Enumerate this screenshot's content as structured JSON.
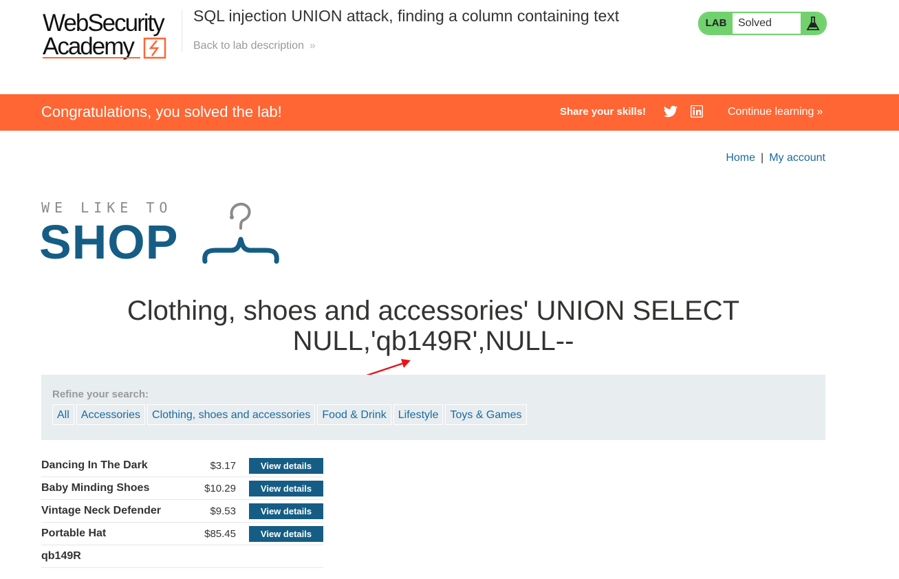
{
  "academy": {
    "logo_line1": "WebSecurity",
    "logo_line2": "Academy",
    "lab_title": "SQL injection UNION attack, finding a column containing text",
    "back_link": "Back to lab description",
    "lab_badge": "LAB",
    "lab_status": "Solved"
  },
  "banner": {
    "message": "Congratulations, you solved the lab!",
    "share": "Share your skills!",
    "continue": "Continue learning"
  },
  "nav": {
    "home": "Home",
    "separator": "|",
    "account": "My account"
  },
  "shop_logo": {
    "tagline": "WE LIKE TO",
    "name": "SHOP"
  },
  "heading": "Clothing, shoes and accessories' UNION SELECT NULL,'qb149R',NULL--",
  "filter": {
    "label": "Refine your search:",
    "categories": [
      "All",
      "Accessories",
      "Clothing, shoes and accessories",
      "Food & Drink",
      "Lifestyle",
      "Toys & Games"
    ]
  },
  "products": [
    {
      "name": "Dancing In The Dark",
      "price": "$3.17",
      "button": "View details"
    },
    {
      "name": "Baby Minding Shoes",
      "price": "$10.29",
      "button": "View details"
    },
    {
      "name": "Vintage Neck Defender",
      "price": "$9.53",
      "button": "View details"
    },
    {
      "name": "Portable Hat",
      "price": "$85.45",
      "button": "View details"
    },
    {
      "name": "qb149R",
      "price": "",
      "button": ""
    }
  ],
  "colors": {
    "brand_orange": "#ff6633",
    "lab_green": "#70d16d",
    "shop_blue": "#155d85",
    "link_blue": "#1a6a9e",
    "filter_bg": "#e8edf0",
    "annotation_red": "#e8141a"
  },
  "icons": {
    "twitter": "twitter-icon",
    "linkedin": "linkedin-icon",
    "flask": "flask-icon",
    "hanger": "hanger-icon",
    "chevron": "double-chevron-right-icon"
  }
}
